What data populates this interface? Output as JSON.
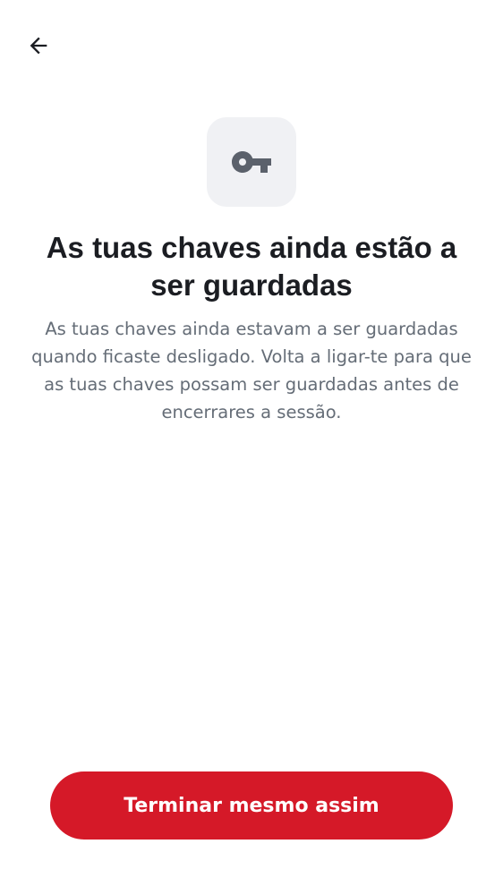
{
  "nav": {
    "back_icon": "arrow-left-icon"
  },
  "hero": {
    "icon": "key-icon",
    "icon_color": "#5b616b",
    "tile_color": "#f0f1f4"
  },
  "content": {
    "title": "As tuas chaves ainda estão a ser guardadas",
    "description": "As tuas chaves ainda estavam a ser guardadas quando ficaste desligado. Volta a ligar-te para que as tuas chaves possam ser guardadas antes de encerrares a sessão."
  },
  "actions": {
    "primary_label": "Terminar mesmo assim",
    "primary_color": "#d51928"
  }
}
